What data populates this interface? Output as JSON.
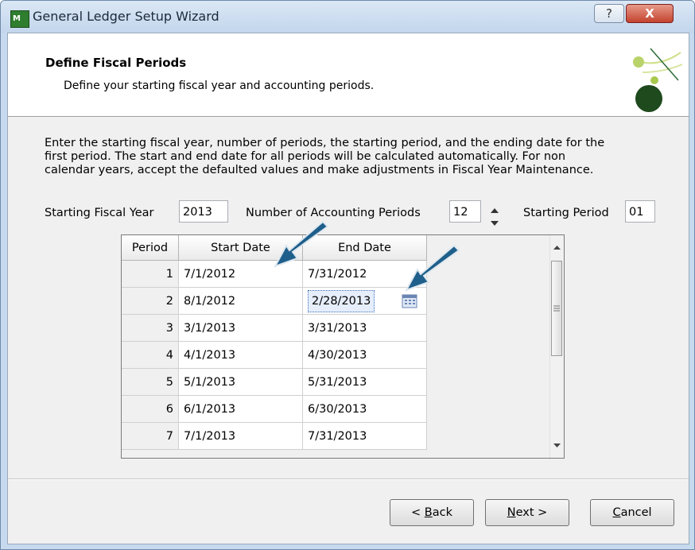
{
  "window": {
    "title": "General Ledger Setup Wizard",
    "help_label": "?",
    "close_label": "X",
    "app_icon_text": "M"
  },
  "header": {
    "title": "Define Fiscal Periods",
    "subtitle": "Define your starting fiscal year and accounting periods."
  },
  "instructions": [
    "Enter the starting fiscal year, number of periods, the starting period, and the ending date for the",
    "first period. The start and end date for all periods will be calculated automatically. For non",
    "calendar years, accept the defaulted values and make adjustments in Fiscal Year Maintenance."
  ],
  "fields": {
    "fiscal_year_label": "Starting Fiscal Year",
    "fiscal_year_value": "2013",
    "num_periods_label": "Number of Accounting Periods",
    "num_periods_value": "12",
    "starting_period_label": "Starting Period",
    "starting_period_value": "01"
  },
  "grid": {
    "columns": [
      "Period",
      "Start Date",
      "End Date"
    ],
    "rows": [
      {
        "period": "1",
        "start": "7/1/2012",
        "end": "7/31/2012"
      },
      {
        "period": "2",
        "start": "8/1/2012",
        "end": "2/28/2013"
      },
      {
        "period": "3",
        "start": "3/1/2013",
        "end": "3/31/2013"
      },
      {
        "period": "4",
        "start": "4/1/2013",
        "end": "4/30/2013"
      },
      {
        "period": "5",
        "start": "5/1/2013",
        "end": "5/31/2013"
      },
      {
        "period": "6",
        "start": "6/1/2013",
        "end": "6/30/2013"
      },
      {
        "period": "7",
        "start": "7/1/2013",
        "end": "7/31/2013"
      }
    ]
  },
  "buttons": {
    "back": {
      "prefix": "< ",
      "hotkey": "B",
      "rest": "ack"
    },
    "next": {
      "hotkey": "N",
      "rest": "ext >"
    },
    "cancel": {
      "hotkey": "C",
      "rest": "ancel"
    }
  },
  "colors": {
    "arrow": "#1f5f8b",
    "selection_border": "#3a6fb8",
    "accent": "#2f7d2f"
  }
}
